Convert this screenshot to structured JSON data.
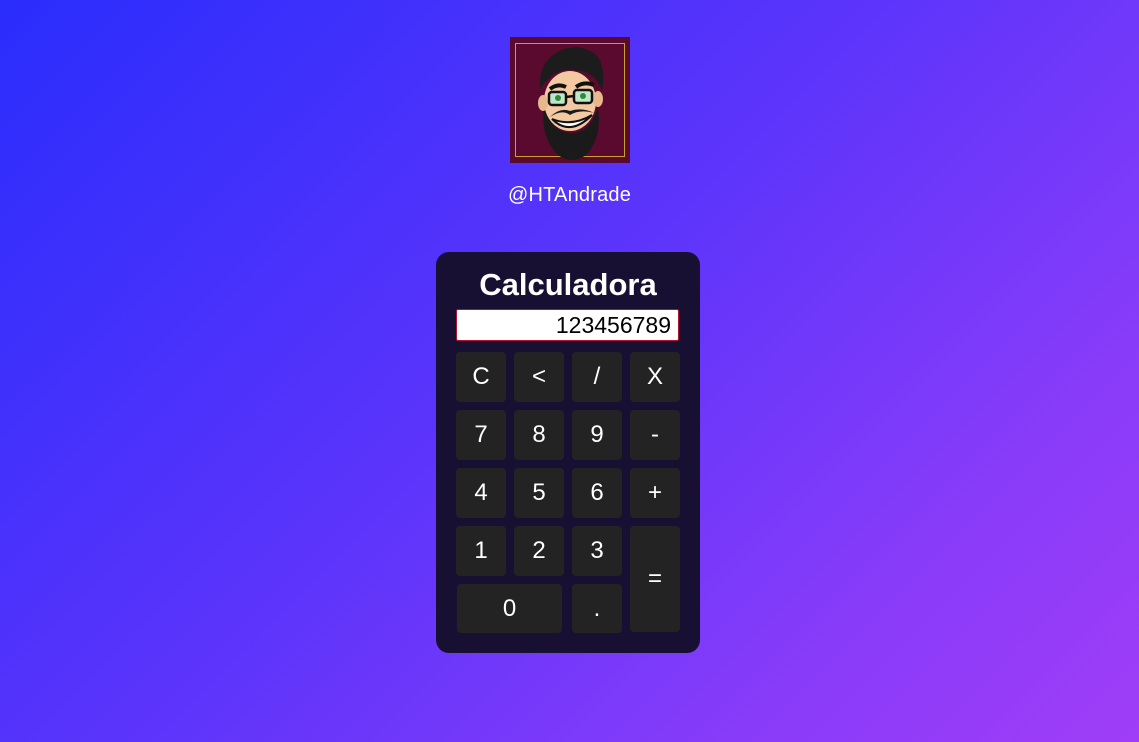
{
  "profile": {
    "username": "@HTAndrade"
  },
  "calculator": {
    "title": "Calculadora",
    "display_value": "123456789",
    "keys": {
      "clear": "C",
      "backspace": "<",
      "divide": "/",
      "multiply": "X",
      "seven": "7",
      "eight": "8",
      "nine": "9",
      "minus": "-",
      "four": "4",
      "five": "5",
      "six": "6",
      "plus": "+",
      "one": "1",
      "two": "2",
      "three": "3",
      "equals": "=",
      "zero": "0",
      "decimal": "."
    }
  },
  "colors": {
    "background_start": "#2a2dfd",
    "background_end": "#a03df8",
    "calculator_body": "#171032",
    "key_background": "#232323",
    "display_border": "#b0142e",
    "avatar_background": "#5a0a2e"
  }
}
